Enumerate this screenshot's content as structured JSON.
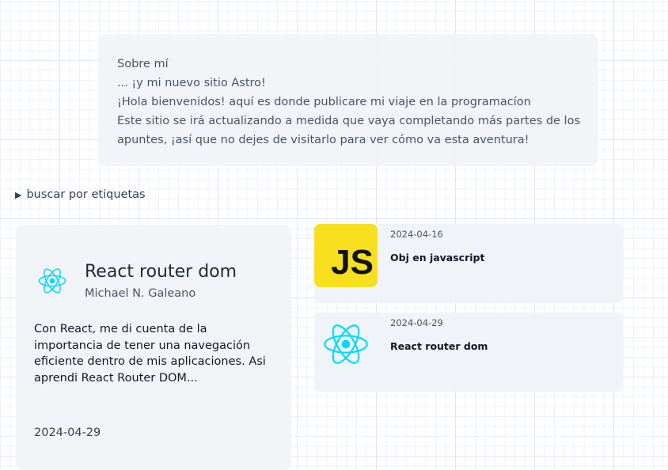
{
  "about": {
    "lines": [
      "Sobre mí",
      "... ¡y mi nuevo sitio Astro!",
      "¡Hola bienvenidos! aquí es donde publicare mi viaje en la programacíon",
      "Este sitio se irá actualizando a medida que vaya completando más partes de los",
      "apuntes, ¡así que no dejes de visitarlo para ver cómo va esta aventura!"
    ]
  },
  "filter": {
    "label": "buscar por etiquetas"
  },
  "featured": {
    "title": "React router dom",
    "author": "Michael N. Galeano",
    "description": "Con React, me di cuenta de la importancia de tener una navegación eficiente dentro de mis aplicaciones. Asi aprendi React Router DOM...",
    "date": "2024-04-29",
    "icon": "react-icon"
  },
  "posts": [
    {
      "date": "2024-04-16",
      "title": "Obj en javascript",
      "thumb_text": "JS",
      "icon": "javascript-logo"
    },
    {
      "date": "2024-04-29",
      "title": "React router dom",
      "icon": "react-icon"
    }
  ],
  "colors": {
    "react": "#00d8ff",
    "js": "#f7df1e"
  }
}
